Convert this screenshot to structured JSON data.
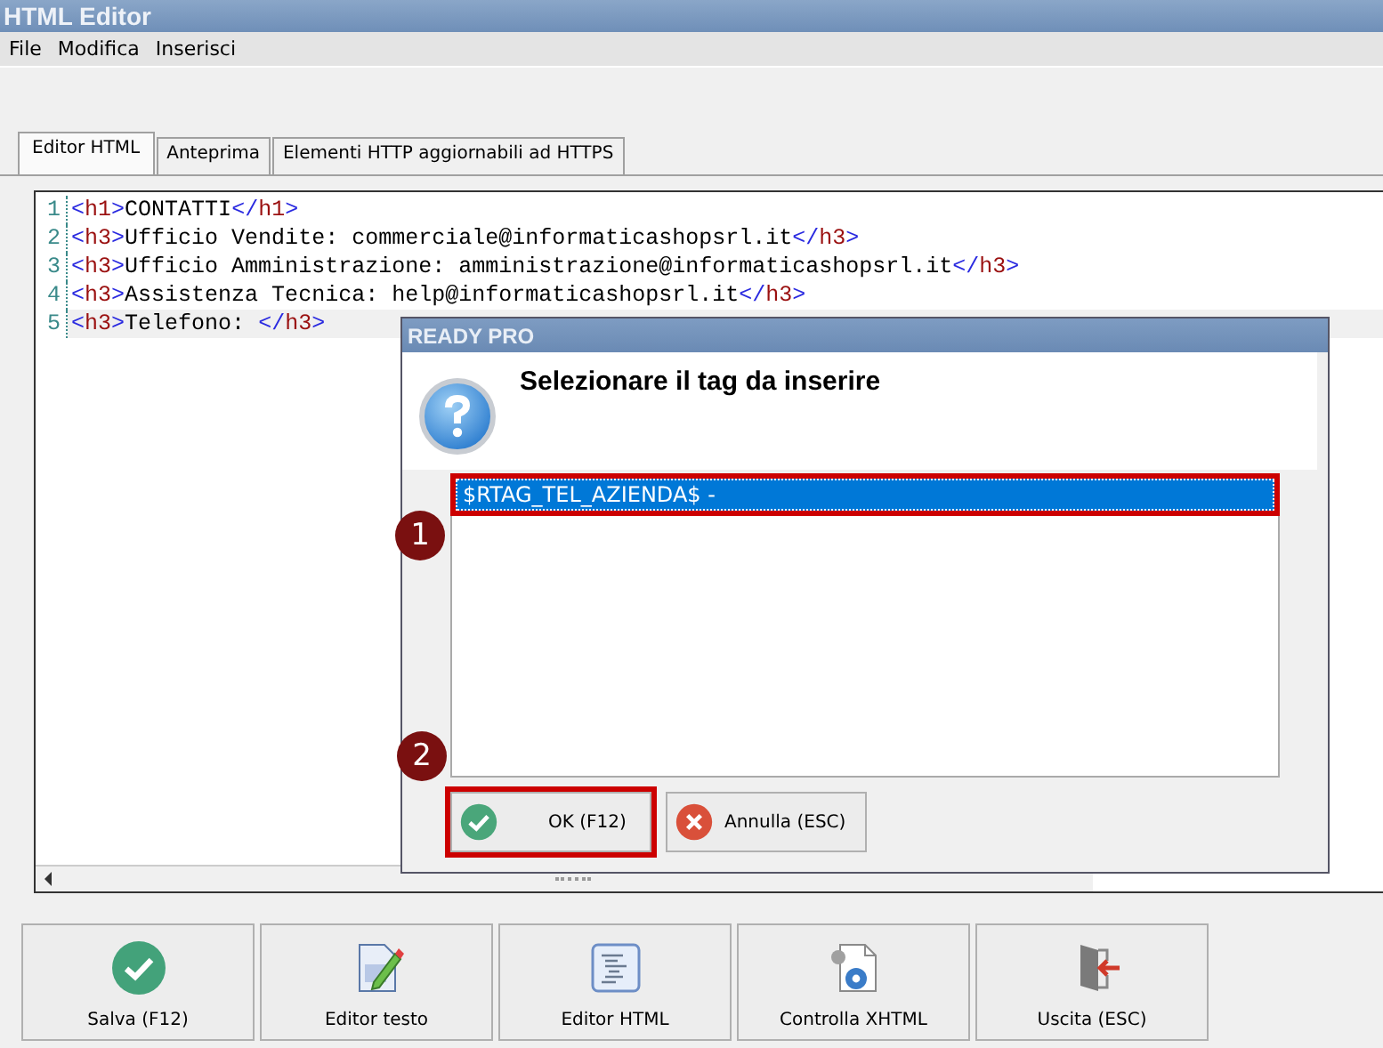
{
  "window": {
    "title": "HTML Editor"
  },
  "menu": [
    "File",
    "Modifica",
    "Inserisci"
  ],
  "tabs": [
    {
      "label": "Editor HTML",
      "selected": true
    },
    {
      "label": "Anteprima",
      "selected": false
    },
    {
      "label": "Elementi HTTP aggiornabili ad HTTPS",
      "selected": false
    }
  ],
  "editor": {
    "lines": [
      {
        "number": "1",
        "code": "<h1>CONTATTI</h1>",
        "current": false
      },
      {
        "number": "2",
        "code": "<h3>Ufficio Vendite: commerciale@informaticashopsrl.it</h3>",
        "current": false
      },
      {
        "number": "3",
        "code": "<h3>Ufficio Amministrazione: amministrazione@informaticashopsrl.it</h3>",
        "current": false
      },
      {
        "number": "4",
        "code": "<h3>Assistenza Tecnica: help@informaticashopsrl.it</h3>",
        "current": false
      },
      {
        "number": "5",
        "code": "<h3>Telefono: </h3>",
        "current": true
      }
    ]
  },
  "dialog": {
    "title": "READY PRO",
    "message": "Selezionare il tag da inserire",
    "items": [
      {
        "label": "$RTAG_TEL_AZIENDA$ -",
        "selected": true
      }
    ],
    "buttons": [
      {
        "label": "OK (F12)",
        "kind": "ok"
      },
      {
        "label": "Annulla (ESC)",
        "kind": "cancel"
      }
    ]
  },
  "callouts": [
    "1",
    "2"
  ],
  "toolbar": [
    {
      "label": "Salva (F12)",
      "kind": "save"
    },
    {
      "label": "Editor testo",
      "kind": "text"
    },
    {
      "label": "Editor HTML",
      "kind": "html"
    },
    {
      "label": "Controlla XHTML",
      "kind": "check"
    },
    {
      "label": "Uscita (ESC)",
      "kind": "exit"
    }
  ]
}
